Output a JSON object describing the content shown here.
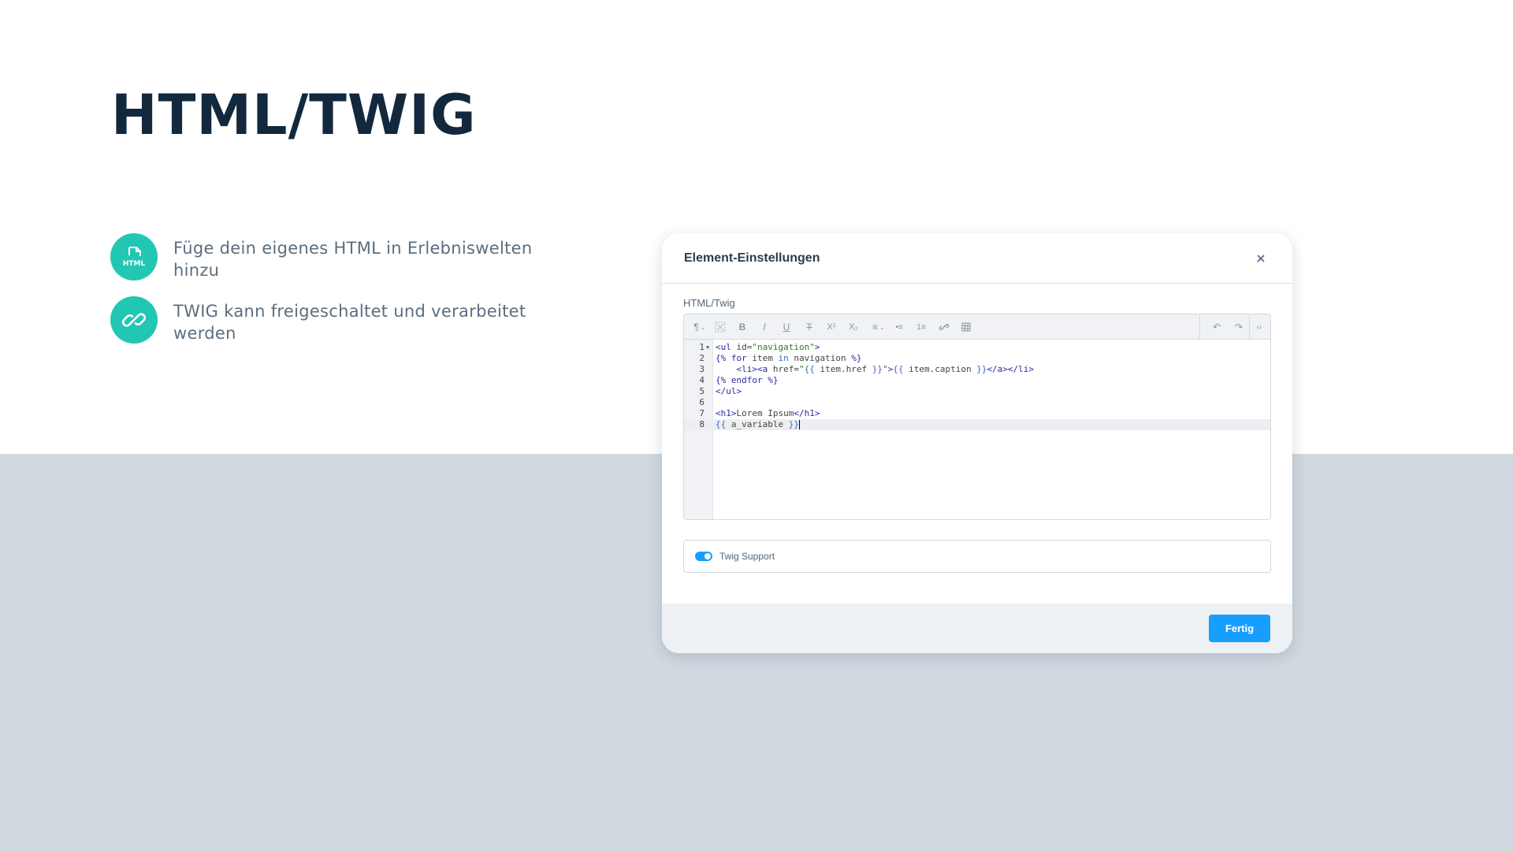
{
  "page": {
    "title": "HTML/TWIG",
    "features": [
      {
        "icon": "html-file-icon",
        "icon_text": "HTML",
        "text": "Füge dein eigenes HTML in Erlebniswelten hinzu"
      },
      {
        "icon": "link-icon",
        "text": "TWIG kann freigeschaltet und verarbeitet werden"
      }
    ]
  },
  "modal": {
    "title": "Element-Einstellungen",
    "close_icon": "close-icon",
    "field_label": "HTML/Twig",
    "toolbar_icons": [
      "paragraph-format-icon",
      "clear-format-icon",
      "bold-icon",
      "italic-icon",
      "underline-icon",
      "strikethrough-icon",
      "superscript-icon",
      "subscript-icon",
      "align-icon",
      "unordered-list-icon",
      "ordered-list-icon",
      "link-icon",
      "table-icon",
      "undo-icon",
      "redo-icon",
      "code-view-icon"
    ],
    "toolbar_glyphs": {
      "paragraph": "¶",
      "bold": "B",
      "italic": "I",
      "underline": "U",
      "strike": "T",
      "sup": "X²",
      "sub": "X₂",
      "align": "≡",
      "ul": "•≡",
      "ol": "1≡",
      "link": "🔗",
      "table": "▦",
      "undo": "↶",
      "redo": "↷",
      "code": "‹›"
    },
    "editor": {
      "active_line": 8,
      "lines": [
        {
          "n": "1"
        },
        {
          "n": "2"
        },
        {
          "n": "3"
        },
        {
          "n": "4"
        },
        {
          "n": "5"
        },
        {
          "n": "6"
        },
        {
          "n": "7"
        },
        {
          "n": "8"
        }
      ],
      "code": {
        "l1": [
          "<ul",
          " id=",
          "\"navigation\"",
          ">"
        ],
        "l2": [
          "{%",
          " for",
          " item ",
          "in",
          " navigation ",
          "%}"
        ],
        "l3": [
          "    <li><a",
          " href=",
          "\"",
          "{{",
          " item.href ",
          "}}",
          "\"",
          ">",
          "{{",
          " item.caption ",
          "}}",
          "</a></li>"
        ],
        "l4": [
          "{%",
          " endfor",
          " %}"
        ],
        "l5": [
          "</ul>"
        ],
        "l7": [
          "<h1>",
          "Lorem Ipsum",
          "</h1>"
        ],
        "l8": [
          "{{",
          " a_variable ",
          "}}"
        ]
      }
    },
    "twig_support": {
      "label": "Twig Support",
      "enabled": true
    },
    "done_label": "Fertig"
  },
  "colors": {
    "accent": "#189eff",
    "feature_icon_bg": "#22c7b4",
    "band": "#d0d8e0"
  }
}
